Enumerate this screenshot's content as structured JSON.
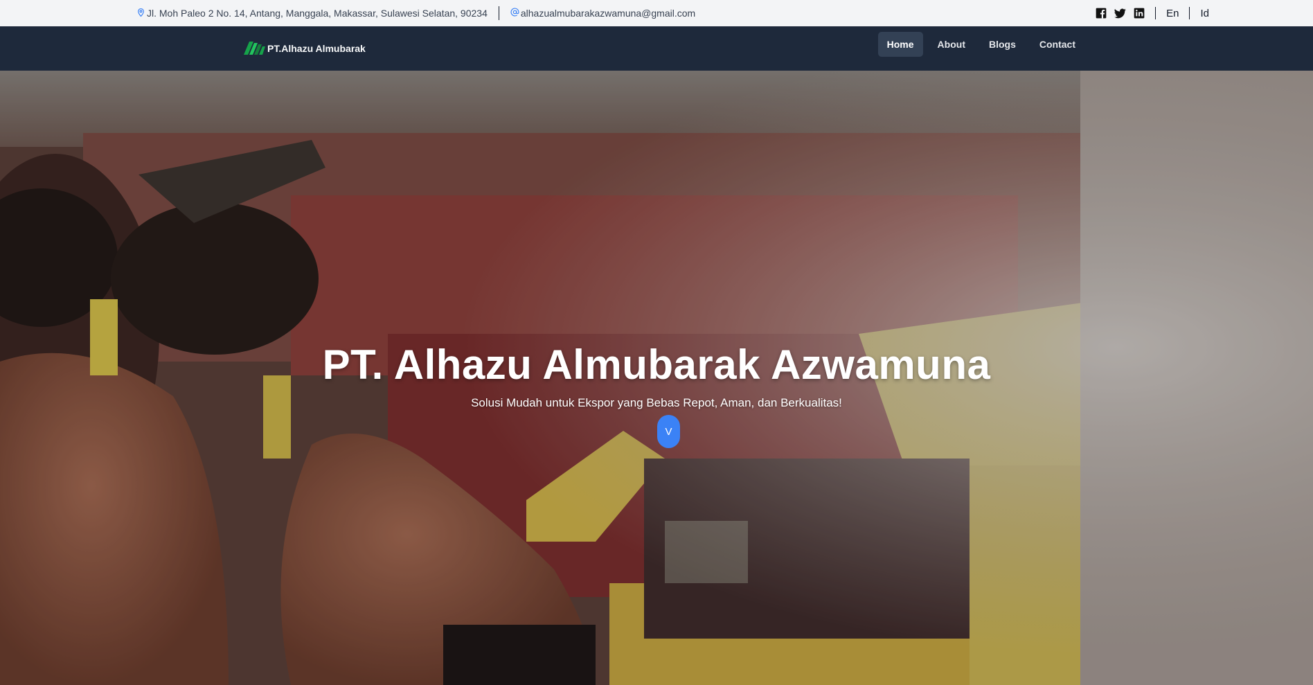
{
  "topbar": {
    "address": "Jl. Moh Paleo 2 No. 14, Antang, Manggala, Makassar, Sulawesi Selatan, 90234",
    "email": "alhazualmubarakazwamuna@gmail.com",
    "languages": [
      "En",
      "Id"
    ]
  },
  "navbar": {
    "brand": "PT.Alhazu Almubarak",
    "links": [
      "Home",
      "About",
      "Blogs",
      "Contact"
    ],
    "active": "Home"
  },
  "hero": {
    "title": "PT. Alhazu Almubarak Azwamuna",
    "subtitle": "Solusi Mudah untuk Ekspor yang Bebas Repot, Aman, dan Berkualitas!",
    "scroll_button": "V"
  },
  "colors": {
    "topbar_bg": "#f3f4f6",
    "navbar_bg": "#1e293b",
    "accent": "#3b82f6",
    "logo_green": "#16a34a"
  },
  "icons": {
    "address": "map-pin-icon",
    "email": "at-sign-icon",
    "social": [
      "facebook-icon",
      "twitter-icon",
      "linkedin-icon"
    ]
  }
}
